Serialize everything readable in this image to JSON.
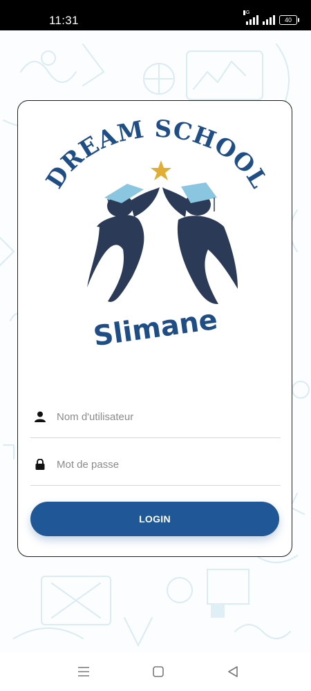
{
  "status_bar": {
    "time": "11:31",
    "network": "4G",
    "battery": "40"
  },
  "logo": {
    "arc_text": "DREAM SCHOOL",
    "wordmark": "Slimane"
  },
  "form": {
    "username_placeholder": "Nom d'utilisateur",
    "password_placeholder": "Mot de passe",
    "login_label": "LOGIN"
  },
  "colors": {
    "primary": "#1f5797",
    "logo_blue": "#1f4d86",
    "figure": "#2b3b57",
    "cap": "#8ac6df",
    "star": "#e1ad33"
  },
  "icons": {
    "username": "user-icon",
    "password": "lock-icon",
    "nav_menu": "menu-icon",
    "nav_home": "home-icon",
    "nav_back": "back-icon"
  }
}
